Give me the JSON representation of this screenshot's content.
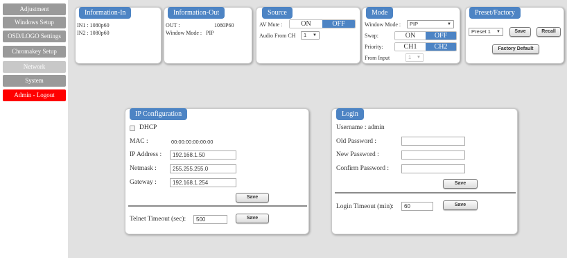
{
  "sidebar": {
    "items": [
      {
        "label": "Adjustment"
      },
      {
        "label": "Windows Setup"
      },
      {
        "label": "OSD/LOGO Settings"
      },
      {
        "label": "Chromakey Setup"
      },
      {
        "label": "Network"
      },
      {
        "label": "System"
      },
      {
        "label": "Admin - Logout"
      }
    ]
  },
  "info_in": {
    "title": "Information-In",
    "in1": "IN1 : 1080p60",
    "in2": "IN2 : 1080p60"
  },
  "info_out": {
    "title": "Information-Out",
    "out_label": "OUT :",
    "out_value": "1080P60",
    "window_mode_label": "Window Mode :",
    "window_mode_value": "PIP"
  },
  "source": {
    "title": "Source",
    "av_mute_label": "AV Mute :",
    "on": "ON",
    "off": "OFF",
    "audio_from_label": "Audio From CH",
    "audio_from_value": "1"
  },
  "mode": {
    "title": "Mode",
    "window_mode_label": "Window Mode :",
    "window_mode_value": "PIP",
    "swap_label": "Swap:",
    "on": "ON",
    "off": "OFF",
    "priority_label": "Priority:",
    "ch1": "CH1",
    "ch2": "CH2",
    "from_input_label": "From Input",
    "from_input_value": "1"
  },
  "preset": {
    "title": "Preset/Factory",
    "preset_value": "Preset 1",
    "save": "Save",
    "recall": "Recall",
    "factory_default": "Factory Default"
  },
  "ip_config": {
    "title": "IP Configuration",
    "dhcp": "DHCP",
    "mac_label": "MAC :",
    "mac_value": "00:00:00:00:00:00",
    "ip_label": "IP Address :",
    "ip_value": "192.168.1.50",
    "netmask_label": "Netmask :",
    "netmask_value": "255.255.255.0",
    "gateway_label": "Gateway :",
    "gateway_value": "192.168.1.254",
    "save": "Save",
    "telnet_label": "Telnet Timeout (sec):",
    "telnet_value": "500",
    "telnet_save": "Save"
  },
  "login": {
    "title": "Login",
    "username": "Username : admin",
    "old_label": "Old Password :",
    "new_label": "New Password :",
    "confirm_label": "Confirm Password :",
    "save": "Save",
    "timeout_label": "Login Timeout (min):",
    "timeout_value": "60",
    "timeout_save": "Save"
  }
}
